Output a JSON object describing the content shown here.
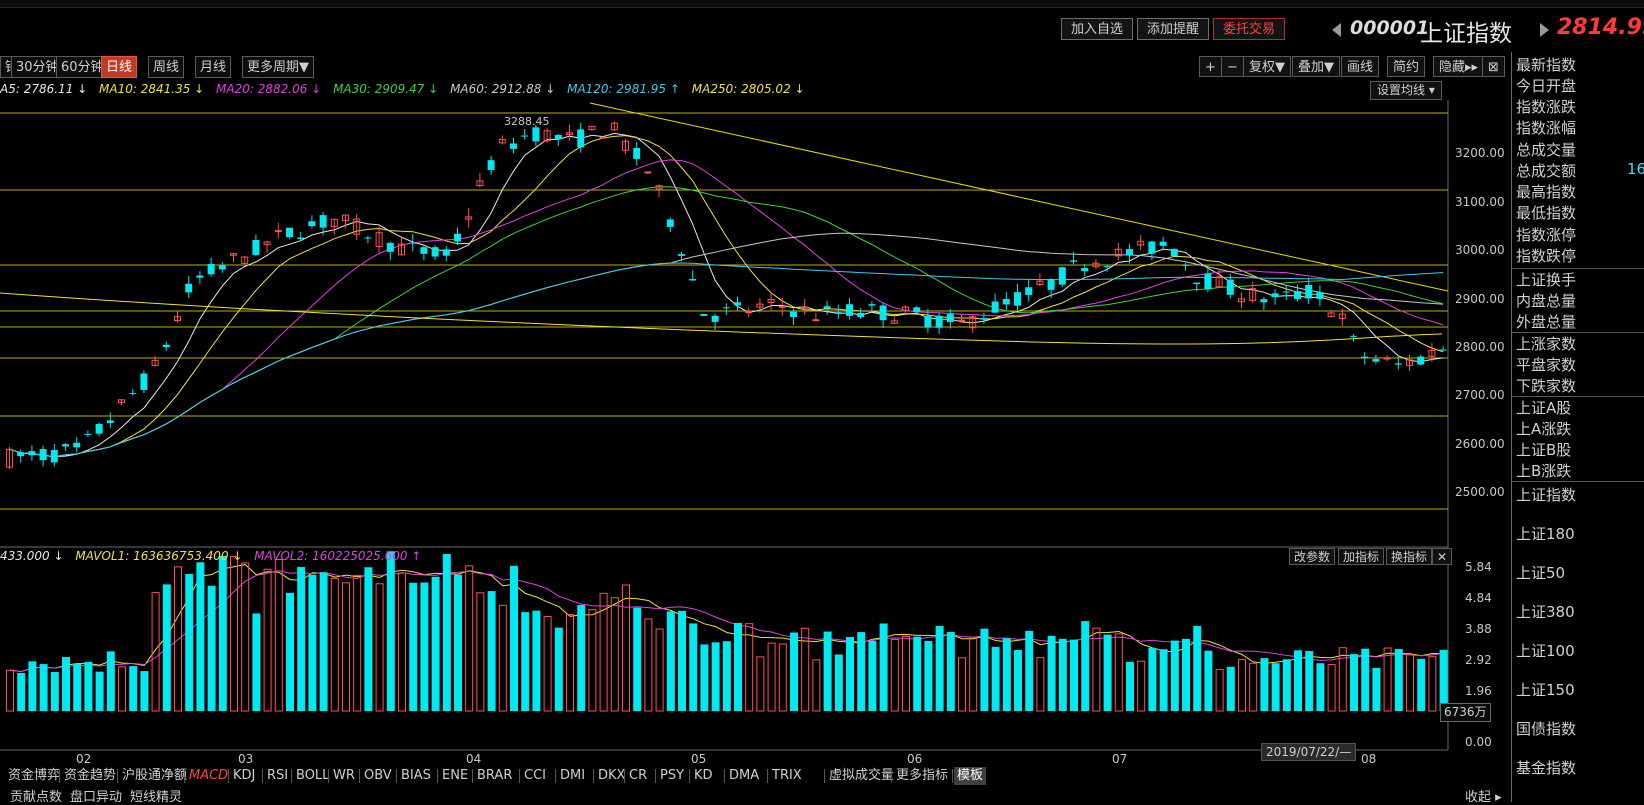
{
  "header": {
    "buttons": [
      "加入自选",
      "添加提醒",
      "委托交易"
    ],
    "stock_code": "000001",
    "stock_name": "上证指数",
    "price": "2814.99"
  },
  "period_tabs": [
    "钟",
    "30分钟",
    "60分钟",
    "日线",
    "周线",
    "月线",
    "更多周期▼"
  ],
  "active_period": "日线",
  "chart_tools": [
    "+",
    "−",
    "复权▼",
    "叠加▼",
    "画线",
    "简约",
    "隐藏▸▸",
    "⊠"
  ],
  "ma_legend": [
    {
      "text": "A5: 2786.11 ↓",
      "color": "#e8e8e8"
    },
    {
      "text": "MA10: 2841.35 ↓",
      "color": "#f0e040"
    },
    {
      "text": "MA20: 2882.06 ↓",
      "color": "#e040e0"
    },
    {
      "text": "MA30: 2909.47 ↓",
      "color": "#40d040"
    },
    {
      "text": "MA60: 2912.88 ↓",
      "color": "#c8c8c8"
    },
    {
      "text": "MA120: 2981.95 ↑",
      "color": "#40c8e8"
    },
    {
      "text": "MA250: 2805.02 ↓",
      "color": "#f0e040"
    }
  ],
  "set_ma_label": "设置均线 ▾",
  "price_axis": [
    "3200.00",
    "3100.00",
    "3000.00",
    "2900.00",
    "2800.00",
    "2700.00",
    "2600.00",
    "2500.00"
  ],
  "peak_label": "3288.45",
  "vol_legend": [
    {
      "text": "433.000 ↓",
      "color": "#e8e8e8"
    },
    {
      "text": "MAVOL1: 163636753.400 ↓",
      "color": "#f0e040"
    },
    {
      "text": "MAVOL2: 160225025.600 ↑",
      "color": "#e040e0"
    }
  ],
  "vol_buttons": [
    "改参数",
    "加指标",
    "换指标",
    "✕"
  ],
  "vol_axis": [
    "5.84",
    "4.84",
    "3.88",
    "2.92",
    "1.96",
    "0.00"
  ],
  "vol_unit": "6736万",
  "month_labels": [
    "02",
    "03",
    "04",
    "05",
    "06",
    "07",
    "08"
  ],
  "date_box": "2019/07/22/—",
  "side_panel": {
    "group1": [
      "最新指数",
      "今日开盘",
      "指数涨跌",
      "指数涨幅",
      "总成交量",
      "总成交额",
      "最高指数",
      "最低指数",
      "指数涨停",
      "指数跌停"
    ],
    "partial_value": "16",
    "group2": [
      "上证换手",
      "内盘总量",
      "外盘总量"
    ],
    "group3": [
      "上涨家数",
      "平盘家数",
      "下跌家数"
    ],
    "group4": [
      "上证A股",
      "上A涨跌",
      "上证B股",
      "上B涨跌"
    ],
    "group5": [
      "上证指数",
      "上证180",
      "上证50",
      "上证380",
      "上证100",
      "上证150",
      "国债指数",
      "基金指数"
    ]
  },
  "bottom_tabs": [
    "资金博弈",
    "资金趋势",
    "沪股通净额",
    "MACD",
    "KDJ",
    "RSI",
    "BOLL",
    "WR",
    "OBV",
    "BIAS",
    "ENE",
    "BRAR",
    "CCI",
    "DMI",
    "DKX",
    "CR",
    "PSY",
    "KD",
    "DMA",
    "TRIX",
    "虚拟成交量",
    "更多指标",
    "模板"
  ],
  "bottom_active": "模板",
  "last_row": [
    "贡献点数",
    "盘口异动",
    "短线精灵"
  ],
  "last_row_right": "收起 ▸",
  "colors": {
    "up": "#ff5050",
    "down": "#00e8f0",
    "grid": "#b8b000",
    "axis": "#6a6a6a"
  }
}
